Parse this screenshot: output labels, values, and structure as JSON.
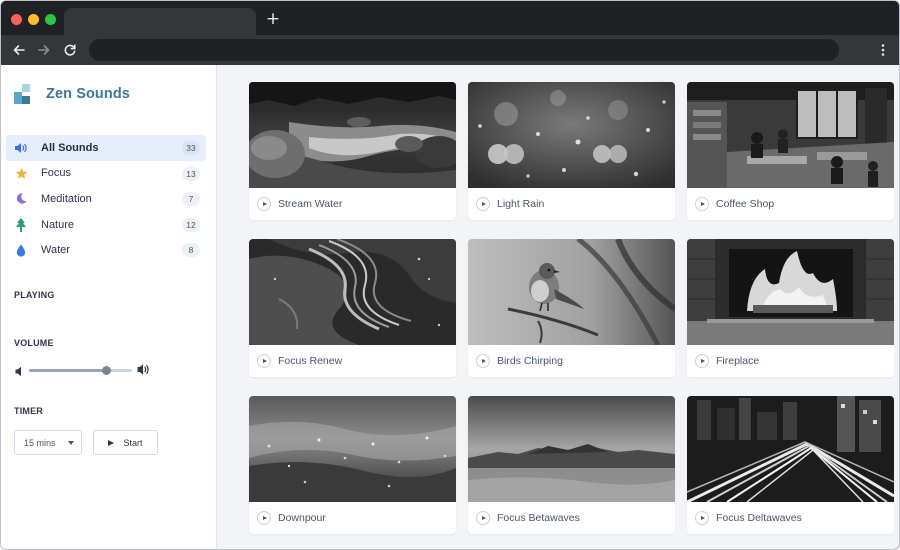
{
  "browser": {
    "tab_title": "",
    "new_tab_icon": "plus-icon",
    "nav_icons": [
      "arrow-left-icon",
      "arrow-right-icon",
      "reload-icon",
      "kebab-menu-icon"
    ]
  },
  "brand": {
    "name": "Zen Sounds",
    "logo_colors": [
      "#5aa9c6",
      "#a7d6e6",
      "#3a7a96"
    ]
  },
  "categories": [
    {
      "label": "All Sounds",
      "count": "33",
      "icon": "speaker-icon",
      "color": "#3b6fe0",
      "active": true
    },
    {
      "label": "Focus",
      "count": "13",
      "icon": "star-icon",
      "color": "#f2b230",
      "active": false
    },
    {
      "label": "Meditation",
      "count": "7",
      "icon": "moon-icon",
      "color": "#8b6fd6",
      "active": false
    },
    {
      "label": "Nature",
      "count": "12",
      "icon": "tree-icon",
      "color": "#2f9e6f",
      "active": false
    },
    {
      "label": "Water",
      "count": "8",
      "icon": "water-drop-icon",
      "color": "#3b7be0",
      "active": false
    }
  ],
  "sections": {
    "playing": "PLAYING",
    "volume": "VOLUME",
    "timer": "TIMER"
  },
  "volume": {
    "level": 0.75
  },
  "timer": {
    "selected": "15 mins",
    "start_label": "Start"
  },
  "sounds": [
    {
      "title": "Stream Water"
    },
    {
      "title": "Light Rain"
    },
    {
      "title": "Coffee Shop"
    },
    {
      "title": "Focus Renew"
    },
    {
      "title": "Birds Chirping"
    },
    {
      "title": "Fireplace"
    },
    {
      "title": "Downpour"
    },
    {
      "title": "Focus Betawaves"
    },
    {
      "title": "Focus Deltawaves"
    }
  ]
}
